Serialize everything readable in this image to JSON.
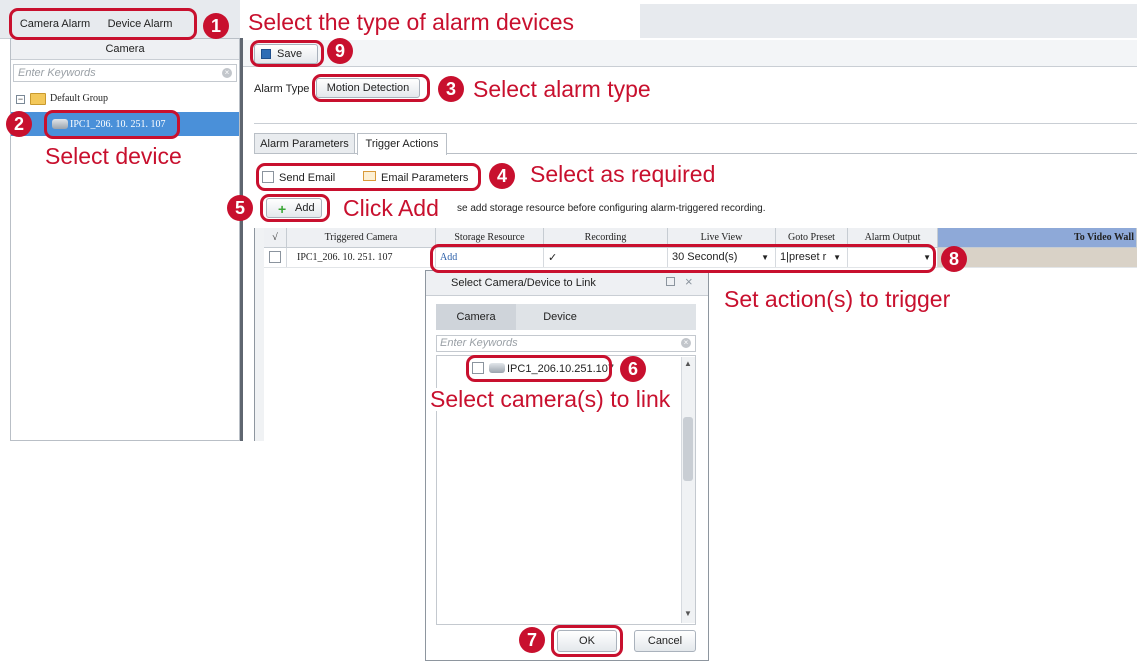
{
  "left_tabs": {
    "camera_alarm": "Camera Alarm",
    "device_alarm": "Device Alarm"
  },
  "left_panel": {
    "header": "Camera",
    "search_placeholder": "Enter Keywords",
    "group": "Default Group",
    "device": "IPC1_206. 10. 251. 107"
  },
  "toolbar": {
    "save": "Save"
  },
  "alarm_type": {
    "label": "Alarm Type",
    "value": "Motion Detection"
  },
  "tabs": {
    "parameters": "Alarm Parameters",
    "trigger": "Trigger Actions"
  },
  "email": {
    "send": "Send Email",
    "params": "Email Parameters"
  },
  "add": {
    "label": "Add",
    "notice": "se add storage resource before configuring alarm-triggered recording."
  },
  "table": {
    "headers": {
      "check": "√",
      "triggered_camera": "Triggered Camera",
      "storage": "Storage Resource",
      "recording": "Recording",
      "live_view": "Live View",
      "goto_preset": "Goto Preset",
      "alarm_output": "Alarm Output",
      "video_wall": "To Video Wall"
    },
    "row": {
      "camera": "IPC1_206. 10. 251. 107",
      "storage": "Add",
      "recording": "✓",
      "live_view": "30 Second(s)",
      "goto_preset": "1|preset r"
    }
  },
  "dialog": {
    "title": "Select Camera/Device to Link",
    "tab_camera": "Camera",
    "tab_device": "Device",
    "search_placeholder": "Enter Keywords",
    "item": "IPC1_206.10.251.107",
    "ok": "OK",
    "cancel": "Cancel"
  },
  "annotations": {
    "a1": "Select the type of alarm devices",
    "a2": "Select device",
    "a3": "Select alarm type",
    "a4": "Select as required",
    "a5": "Click Add",
    "a6": "Select camera(s) to link",
    "a8": "Set action(s) to trigger",
    "n1": "1",
    "n2": "2",
    "n3": "3",
    "n4": "4",
    "n5": "5",
    "n6": "6",
    "n7": "7",
    "n8": "8",
    "n9": "9"
  },
  "colors": {
    "accent": "#c8102e",
    "selected_row": "#4a90d9",
    "table_header_highlight": "#8ea9d8"
  }
}
